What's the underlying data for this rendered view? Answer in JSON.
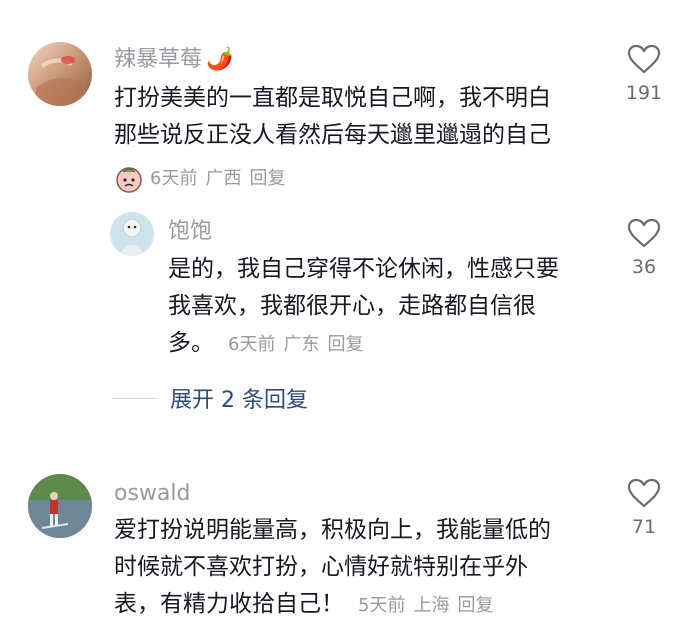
{
  "comments": [
    {
      "username": "辣暴草莓",
      "username_emoji": "🌶️",
      "lines": [
        "打扮美美的一直都是取悦自己啊，我不明白",
        "那些说反正没人看然后每天邋里邋遢的自己"
      ],
      "time": "6天前",
      "location": "广西",
      "reply": "回复",
      "likes": "191"
    },
    {
      "username": "饱饱",
      "lines": [
        "是的，我自己穿得不论休闲，性感只要",
        "我喜欢，我都很开心，走路都自信很",
        "多。"
      ],
      "time": "6天前",
      "location": "广东",
      "reply": "回复",
      "likes": "36"
    },
    {
      "username": "oswald",
      "lines": [
        "爱打扮说明能量高，积极向上，我能量低的",
        "时候就不喜欢打扮，心情好就特别在乎外",
        "表，有精力收拾自己！"
      ],
      "time": "5天前",
      "location": "上海",
      "reply": "回复",
      "likes": "71"
    }
  ],
  "expand_replies": "展开 2 条回复",
  "colors": {
    "text": "#161823",
    "meta": "#9a9aa0",
    "link": "#2d4a7a",
    "heart": "#6b6b70"
  }
}
